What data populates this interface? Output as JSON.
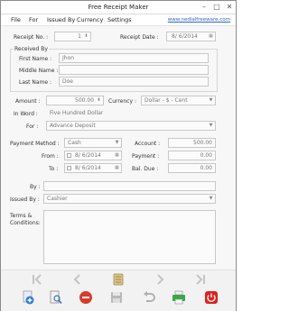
{
  "window": {
    "title": "Free Receipt Maker",
    "minimize": "–",
    "maximize": "□",
    "close": "✕"
  },
  "menu": {
    "file": "File",
    "for": "For",
    "issued_by": "Issued By",
    "currency": "Currency",
    "settings": "Settings",
    "website": "www.nedialfreeware.com"
  },
  "receipt": {
    "no_label": "Receipt No. :",
    "no_value": "1",
    "date_label": "Receipt Date :",
    "date_value": "8/ 6/2014"
  },
  "received_by": {
    "group_label": "Received By",
    "first_label": "First Name :",
    "first_value": "Jhon",
    "middle_label": "Middle Name :",
    "middle_value": "",
    "last_label": "Last Name :",
    "last_value": "Doe"
  },
  "amount": {
    "label": "Amount :",
    "value": "500.00",
    "currency_label": "Currency :",
    "currency_value": "Dollar - $ - Cent"
  },
  "in_word": {
    "label": "In Word :",
    "value": "Five Hundred  Dollar"
  },
  "for": {
    "label": "For :",
    "value": "Advance Deposit"
  },
  "payment": {
    "method_label": "Payment Method :",
    "method_value": "Cash",
    "account_label": "Account :",
    "account_value": "500.00",
    "from_label": "From :",
    "from_value": "8/ 6/2014",
    "payment_label": "Payment :",
    "payment_value": "0.00",
    "to_label": "To :",
    "to_value": "8/ 6/2014",
    "bal_label": "Bal. Due :",
    "bal_value": "0.00"
  },
  "by": {
    "label": "By :",
    "value": ""
  },
  "issued": {
    "label": "Issued By :",
    "value": "Cashier"
  },
  "terms": {
    "label": "Terms &\nConditions:",
    "value": ""
  },
  "colors": {
    "nav_gray": "#c4c4c4",
    "new_blue": "#2e7bd6",
    "delete_red": "#d93a2b",
    "exit_red": "#e02020",
    "print_green": "#39a845"
  },
  "icons": [
    "first-record-icon",
    "previous-record-icon",
    "notes-icon",
    "next-record-icon",
    "last-record-icon",
    "new-receipt-icon",
    "preview-icon",
    "delete-icon",
    "save-icon",
    "undo-icon",
    "print-icon",
    "exit-icon"
  ]
}
